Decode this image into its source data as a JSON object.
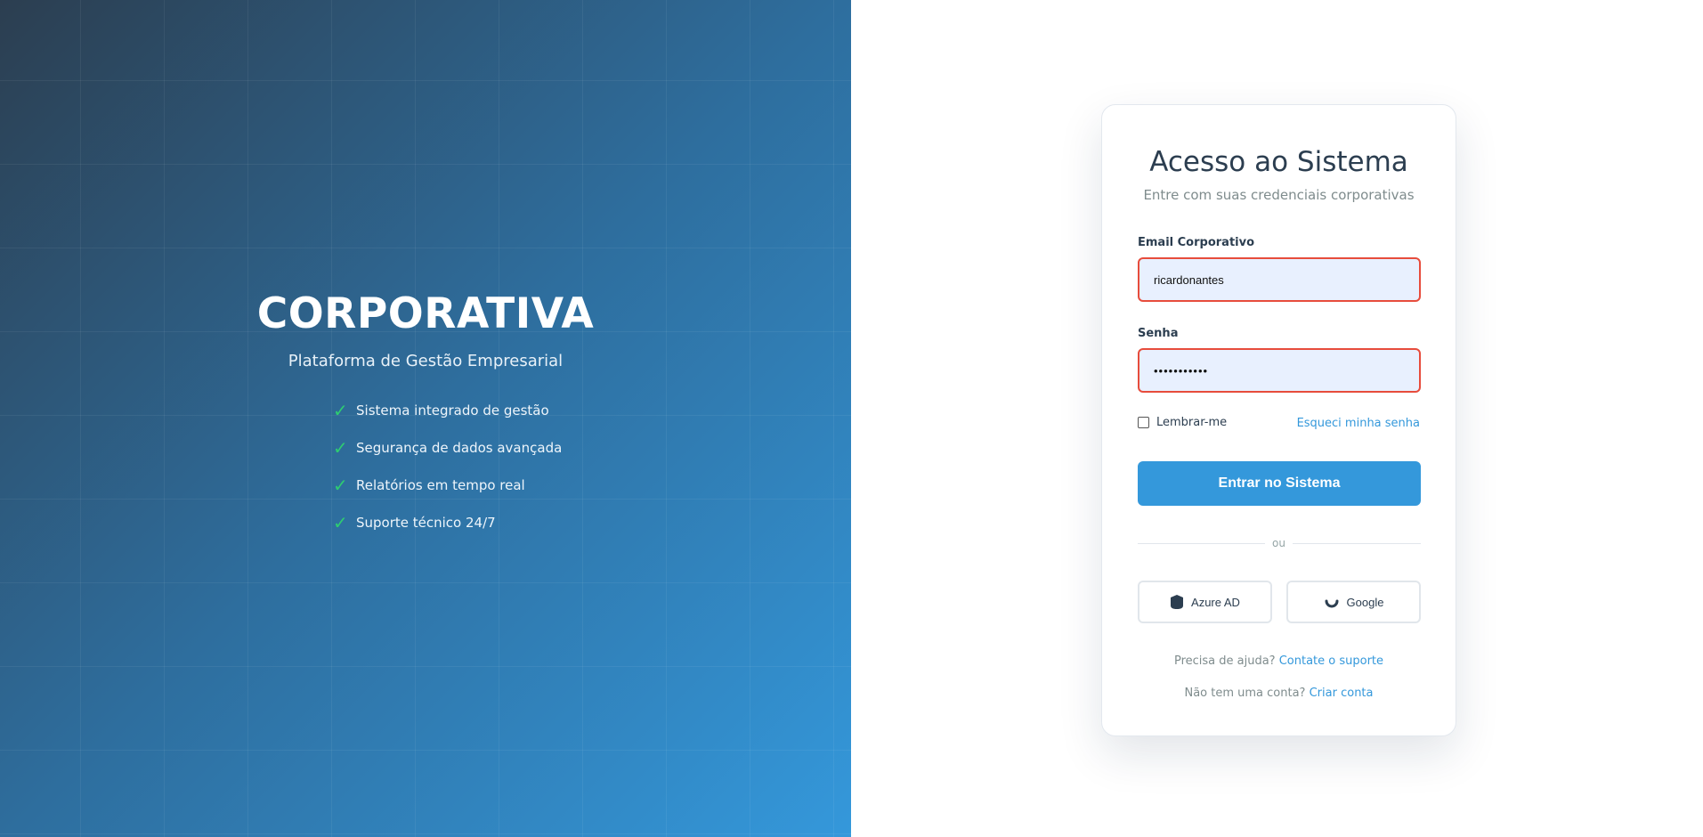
{
  "hero": {
    "brand": "CORPORATIVA",
    "tagline": "Plataforma de Gestão Empresarial",
    "check_icon": "check-icon",
    "features": [
      "Sistema integrado de gestão",
      "Segurança de dados avançada",
      "Relatórios em tempo real",
      "Suporte técnico 24/7"
    ]
  },
  "login": {
    "title": "Acesso ao Sistema",
    "subtitle": "Entre com suas credenciais corporativas",
    "email_label": "Email Corporativo",
    "email_value": "ricardonantes",
    "password_label": "Senha",
    "password_value": "•••••••••••",
    "remember_label": "Lembrar-me",
    "forgot_label": "Esqueci minha senha",
    "submit_label": "Entrar no Sistema",
    "divider_label": "ou",
    "sso": {
      "azure_label": "Azure AD",
      "google_label": "Google"
    },
    "help_prefix": "Precisa de ajuda?",
    "help_link": "Contate o suporte",
    "signup_prefix": "Não tem uma conta?",
    "signup_link": "Criar conta"
  },
  "colors": {
    "accent": "#3498db",
    "error_border": "#e74c3c",
    "check": "#2ecc71",
    "heading": "#2c3e50"
  }
}
